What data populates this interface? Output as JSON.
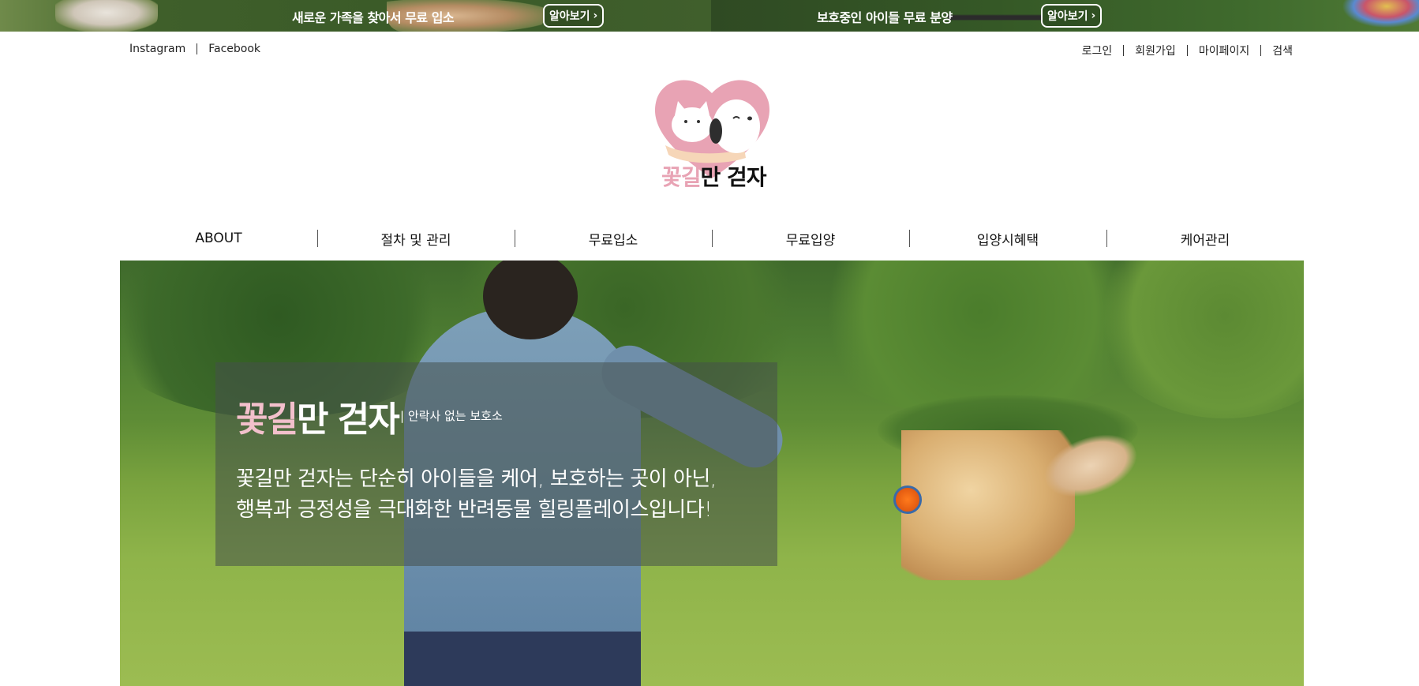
{
  "promo": {
    "left": {
      "text": "새로운 가족을 찾아서 무료 입소",
      "button": "알아보기"
    },
    "right": {
      "text": "보호중인 아이들 무료 분양",
      "button": "알아보기"
    }
  },
  "util": {
    "social": [
      "Instagram",
      "Facebook"
    ],
    "account": [
      "로그인",
      "회원가입",
      "마이페이지",
      "검색"
    ]
  },
  "logo": {
    "word_pink": "꽃길",
    "word_dark": "만 걷자"
  },
  "nav": [
    "ABOUT",
    "절차 및 관리",
    "무료입소",
    "무료입양",
    "입양시혜택",
    "케어관리"
  ],
  "hero": {
    "brand_pink": "꽃길",
    "brand_white": "만 걷자",
    "subtitle": "| 안락사 없는 보호소",
    "desc_line1": "꽃길만 걷자는 단순히 아이들을 케어, 보호하는 곳이 아닌,",
    "desc_line2": "행복과 긍정성을 극대화한 반려동물 힐링플레이스입니다!"
  },
  "colors": {
    "brand_pink": "#e8a3b4",
    "grass_green": "#79a23e"
  }
}
